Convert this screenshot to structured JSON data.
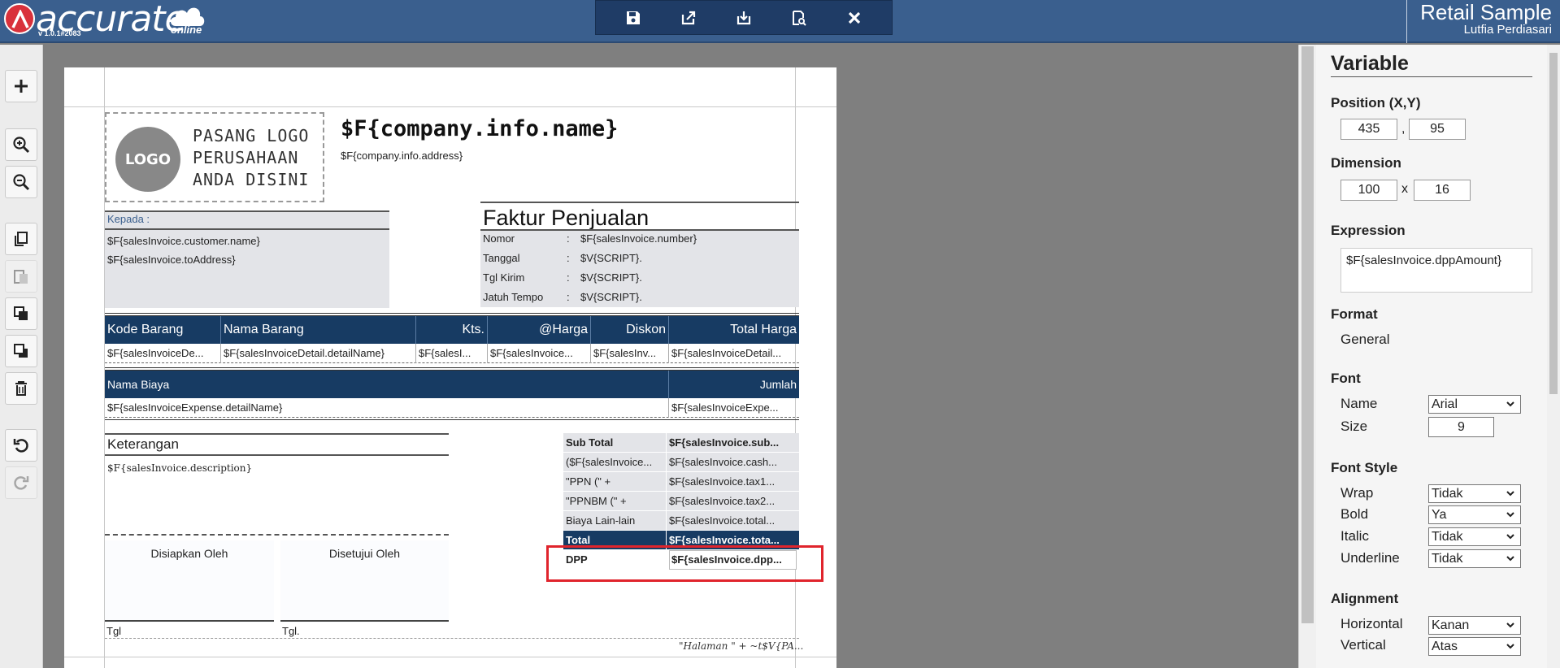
{
  "header": {
    "brand": "accurate",
    "brand_suffix": "online",
    "version": "v 1.0.1#2083",
    "company": "Retail Sample",
    "user": "Lutfia Perdiasari"
  },
  "toolbar": {
    "buttons": [
      "save-icon",
      "export-icon",
      "download-icon",
      "preview-icon",
      "close-icon"
    ]
  },
  "leftbar": {
    "tools": [
      "add-icon",
      "zoom-in-icon",
      "zoom-out-icon",
      "copy-icon",
      "paste-icon",
      "bring-front-icon",
      "send-back-icon",
      "delete-icon",
      "undo-icon",
      "redo-icon"
    ]
  },
  "report": {
    "logo_disc": "LOGO",
    "logo_text": [
      "PASANG LOGO",
      "PERUSAHAAN",
      "ANDA DISINI"
    ],
    "company_var": "$F{company.info.name}",
    "address_var": "$F{company.info.address}",
    "kepada_label": "Kepada :",
    "customer_name": "$F{salesInvoice.customer.name}",
    "to_address": "$F{salesInvoice.toAddress}",
    "faktur_title": "Faktur Penjualan",
    "faktur_rows": [
      {
        "key": "Nomor",
        "sep": ":",
        "value": "$F{salesInvoice.number}"
      },
      {
        "key": "Tanggal",
        "sep": ":",
        "value": "$V{SCRIPT}."
      },
      {
        "key": "Tgl Kirim",
        "sep": ":",
        "value": "$V{SCRIPT}."
      },
      {
        "key": "Jatuh Tempo",
        "sep": ":",
        "value": "$V{SCRIPT}."
      }
    ],
    "detail_headers": [
      "Kode Barang",
      "Nama Barang",
      "Kts.",
      "@Harga",
      "Diskon",
      "Total Harga"
    ],
    "detail_cells": [
      "$F{salesInvoiceDe...",
      "$F{salesInvoiceDetail.detailName}",
      "$F{salesI...",
      "$F{salesInvoice...",
      "$F{salesInv...",
      "$F{salesInvoiceDetail..."
    ],
    "expense_headers": [
      "Nama Biaya",
      "Jumlah"
    ],
    "expense_cells": [
      "$F{salesInvoiceExpense.detailName}",
      "$F{salesInvoiceExpe..."
    ],
    "keterangan_title": "Keterangan",
    "keterangan_var": "$F{salesInvoice.description}",
    "sign_prepared": "Disiapkan Oleh",
    "sign_approved": "Disetujui Oleh",
    "tgl_left": "Tgl",
    "tgl_right": "Tgl.",
    "summary": [
      {
        "key": "Sub Total",
        "value": "$F{salesInvoice.sub..."
      },
      {
        "key": "($F{salesInvoice...",
        "value": "$F{salesInvoice.cash..."
      },
      {
        "key": "\"PPN (\" +",
        "value": "$F{salesInvoice.tax1..."
      },
      {
        "key": "\"PPNBM (\" +",
        "value": "$F{salesInvoice.tax2..."
      },
      {
        "key": "Biaya Lain-lain",
        "value": "$F{salesInvoice.total..."
      },
      {
        "key": "Total",
        "value": "$F{salesInvoice.tota..."
      },
      {
        "key": "DPP",
        "value": "$F{salesInvoice.dpp..."
      }
    ],
    "halaman": "\"Halaman \" + ~t$V{PA..."
  },
  "panel": {
    "title": "Variable",
    "position_label": "Position (X,Y)",
    "pos_x": "435",
    "pos_sep": ",",
    "pos_y": "95",
    "dimension_label": "Dimension",
    "dim_w": "100",
    "dim_sep": "x",
    "dim_h": "16",
    "expression_label": "Expression",
    "expression": "$F{salesInvoice.dppAmount}",
    "format_label": "Format",
    "format_value": "General",
    "font_label": "Font",
    "font_name_label": "Name",
    "font_name": "Arial",
    "font_size_label": "Size",
    "font_size": "9",
    "font_style_label": "Font Style",
    "wrap_label": "Wrap",
    "wrap": "Tidak",
    "bold_label": "Bold",
    "bold": "Ya",
    "italic_label": "Italic",
    "italic": "Tidak",
    "underline_label": "Underline",
    "underline": "Tidak",
    "alignment_label": "Alignment",
    "horizontal_label": "Horizontal",
    "horizontal": "Kanan",
    "vertical_label": "Vertical",
    "vertical": "Atas"
  },
  "colors": {
    "header_bg": "#3a5f8e",
    "toolbar_bg": "#1f3c66",
    "table_header_bg": "#173b63",
    "selection": "#e0242c",
    "logo_red": "#d9313b"
  }
}
